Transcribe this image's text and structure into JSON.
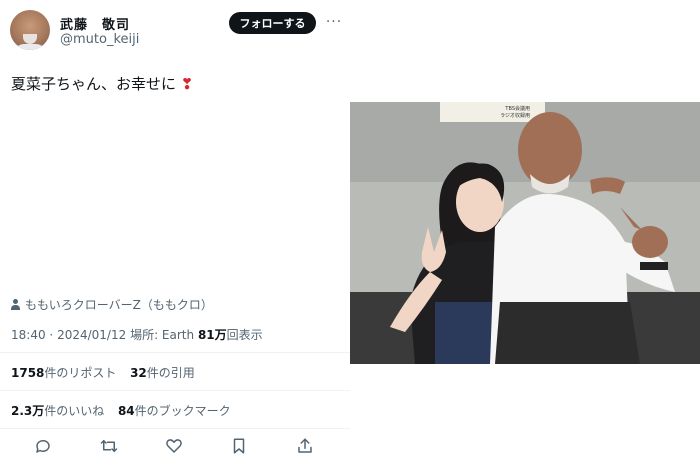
{
  "user": {
    "display_name": "武藤　敬司",
    "handle": "@muto_keiji",
    "follow_label": "フォローする",
    "more_label": "···"
  },
  "tweet": {
    "text": "夏菜子ちゃん、お幸せに",
    "emoji": "❣"
  },
  "tag": {
    "label": "ももいろクローバーZ（ももクロ）"
  },
  "meta": {
    "time": "18:40",
    "separator": "·",
    "date": "2024/01/12",
    "location": "場所: Earth",
    "views_count": "81万",
    "views_label": "回表示"
  },
  "stats": {
    "reposts_count": "1758",
    "reposts_label": "件のリポスト",
    "quotes_count": "32",
    "quotes_label": "件の引用",
    "likes_count": "2.3万",
    "likes_label": "件のいいね",
    "bookmarks_count": "84",
    "bookmarks_label": "件のブックマーク"
  },
  "photo": {
    "sign_line1": "TBS会議用",
    "sign_line2": "ラジオ収録用"
  },
  "actions": [
    "reply-icon",
    "retweet-icon",
    "like-icon",
    "bookmark-icon",
    "share-icon"
  ]
}
